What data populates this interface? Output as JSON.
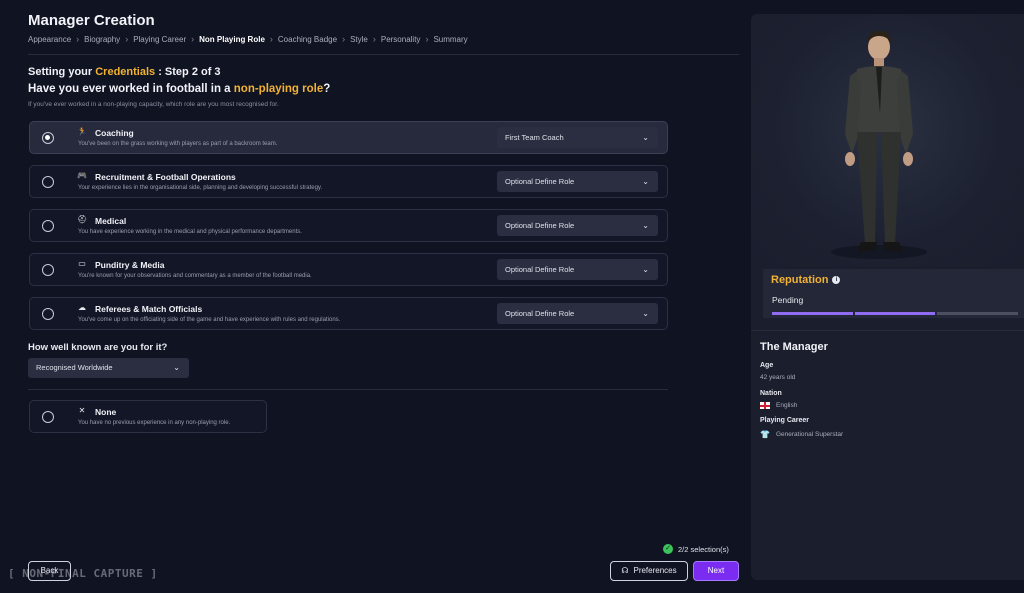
{
  "header": {
    "title": "Manager Creation",
    "breadcrumb": [
      {
        "label": "Appearance",
        "active": false
      },
      {
        "label": "Biography",
        "active": false
      },
      {
        "label": "Playing Career",
        "active": false
      },
      {
        "label": "Non Playing Role",
        "active": true
      },
      {
        "label": "Coaching Badge",
        "active": false
      },
      {
        "label": "Style",
        "active": false
      },
      {
        "label": "Personality",
        "active": false
      },
      {
        "label": "Summary",
        "active": false
      }
    ],
    "separator": "›"
  },
  "step": {
    "prefix": "Setting your ",
    "highlight": "Credentials",
    "suffix": " : Step 2 of 3"
  },
  "question": {
    "prefix": "Have you ever worked in football in a ",
    "highlight": "non-playing role",
    "suffix": "?",
    "hint": "If you've ever worked in a non-playing capacity, which role are you most recognised for."
  },
  "options": [
    {
      "icon": "🏃",
      "icon_name": "coaching-icon",
      "title": "Coaching",
      "desc": "You've been on the grass working with players as part of a backroom team.",
      "role": "First Team Coach",
      "selected": true
    },
    {
      "icon": "🎮",
      "icon_name": "recruitment-icon",
      "title": "Recruitment & Football Operations",
      "desc": "Your experience lies in the organisational side, planning and developing successful strategy.",
      "role": "Optional Define Role",
      "selected": false
    },
    {
      "icon": "⛑",
      "icon_name": "medical-icon",
      "title": "Medical",
      "desc": "You have experience working in the medical and physical performance departments.",
      "role": "Optional Define Role",
      "selected": false
    },
    {
      "icon": "▭",
      "icon_name": "tv-icon",
      "title": "Punditry & Media",
      "desc": "You're known for your observations and commentary as a member of the football media.",
      "role": "Optional Define Role",
      "selected": false
    },
    {
      "icon": "☁",
      "icon_name": "whistle-icon",
      "title": "Referees & Match Officials",
      "desc": "You've come up on the officiating side of the game and have experience with rules and regulations.",
      "role": "Optional Define Role",
      "selected": false
    }
  ],
  "known": {
    "label": "How well known are you for it?",
    "value": "Recognised Worldwide"
  },
  "none_option": {
    "icon": "✕",
    "title": "None",
    "desc": "You have no previous experience in any non-playing role."
  },
  "footer": {
    "selection_count": "2/2 selection(s)",
    "back": "Back",
    "preferences": "Preferences",
    "next": "Next",
    "watermark": "[ NON-FINAL CAPTURE ]"
  },
  "panel": {
    "reputation_title": "Reputation",
    "reputation_status": "Pending",
    "reputation_segments_filled": 2,
    "reputation_segments_total": 3,
    "manager_title": "The Manager",
    "age_label": "Age",
    "age_value": "42 years old",
    "nation_label": "Nation",
    "nation_value": "English",
    "career_label": "Playing Career",
    "career_value": "Generational Superstar"
  },
  "colors": {
    "accent": "#f2b233",
    "primary": "#7a2cf0",
    "background": "#101322",
    "reputation_bar": "#8f6cf2",
    "check": "#3cc35c"
  }
}
